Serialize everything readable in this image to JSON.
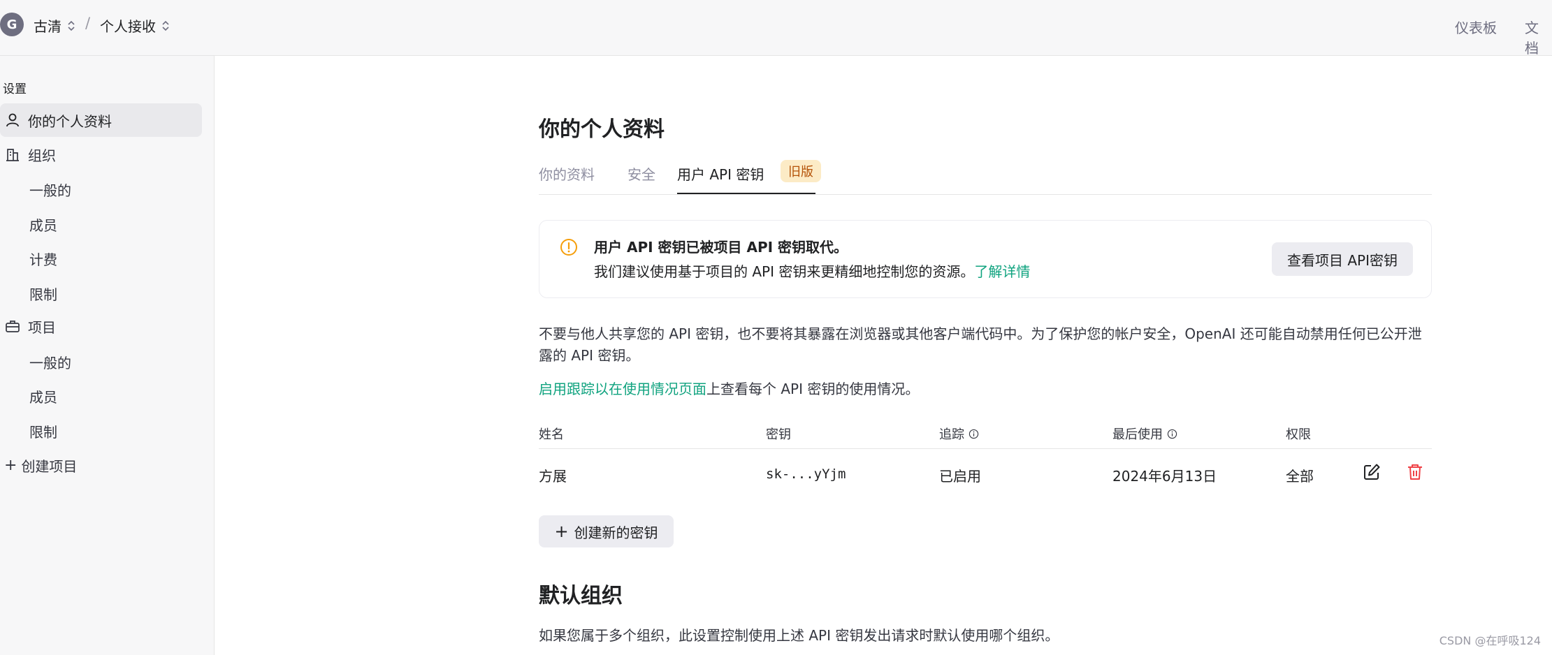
{
  "header": {
    "avatar_letter": "G",
    "org_name": "古清",
    "separator": "/",
    "project_name": "个人接收",
    "nav_dashboard": "仪表板",
    "nav_docs": "文档"
  },
  "sidebar": {
    "section_title": "设置",
    "profile": "你的个人资料",
    "organization": "组织",
    "org_items": [
      "一般的",
      "成员",
      "计费",
      "限制"
    ],
    "projects": "项目",
    "project_items": [
      "一般的",
      "成员",
      "限制"
    ],
    "create_project": "创建项目"
  },
  "main": {
    "title": "你的个人资料",
    "tabs": [
      "你的资料",
      "安全",
      "用户 API 密钥"
    ],
    "legacy_badge": "旧版",
    "notice": {
      "title": "用户 API 密钥已被项目 API 密钥取代。",
      "body": "我们建议使用基于项目的 API 密钥来更精细地控制您的资源。",
      "link": "了解详情",
      "button": "查看项目 API密钥"
    },
    "warning_text": "不要与他人共享您的 API 密钥，也不要将其暴露在浏览器或其他客户端代码中。为了保护您的帐户安全，OpenAI 还可能自动禁用任何已公开泄露的 API 密钥。",
    "tracking_link": "启用跟踪以在使用情况页面",
    "tracking_text": "上查看每个 API 密钥的使用情况。",
    "table": {
      "columns": [
        "姓名",
        "密钥",
        "追踪",
        "最后使用",
        "权限"
      ],
      "rows": [
        {
          "name": "方展",
          "key": "sk-...yYjm",
          "tracking": "已启用",
          "last_used": "2024年6月13日",
          "permission": "全部"
        }
      ]
    },
    "create_key_button": "创建新的密钥",
    "default_org_title": "默认组织",
    "default_org_desc": "如果您属于多个组织，此设置控制使用上述 API 密钥发出请求时默认使用哪个组织。"
  },
  "watermark": "CSDN @在呼吸124",
  "colors": {
    "link_green": "#10a37f",
    "danger_red": "#ef4146",
    "badge_bg": "#fcebc6",
    "badge_text": "#b45309",
    "warning_orange": "#f59e0b"
  }
}
